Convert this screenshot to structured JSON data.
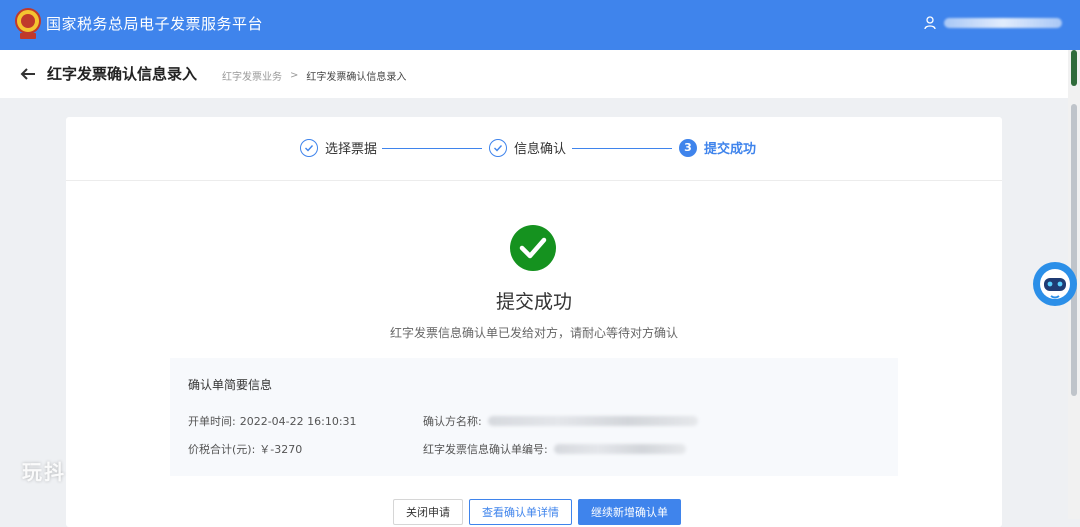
{
  "topbar": {
    "app_title": "国家税务总局电子发票服务平台",
    "bg_color": "#3f84ec"
  },
  "header": {
    "title": "红字发票确认信息录入",
    "breadcrumb": [
      "红字发票业务",
      "红字发票确认信息录入"
    ],
    "breadcrumb_sep": ">"
  },
  "steps": [
    {
      "label": "选择票据",
      "state": "done",
      "icon": "check-circle-icon"
    },
    {
      "label": "信息确认",
      "state": "done",
      "icon": "check-circle-icon"
    },
    {
      "label": "提交成功",
      "state": "active",
      "number": "3"
    }
  ],
  "result": {
    "title": "提交成功",
    "description": "红字发票信息确认单已发给对方，请耐心等待对方确认",
    "icon": "success-check-icon",
    "icon_color": "#15921f"
  },
  "summary": {
    "title": "确认单简要信息",
    "open_time_label": "开单时间:",
    "open_time_value": "2022-04-22 16:10:31",
    "amount_label": "价税合计(元):",
    "amount_value": "￥-3270",
    "confirm_party_label": "确认方名称:",
    "confirm_no_label": "红字发票信息确认单编号:"
  },
  "buttons": {
    "close": "关闭申请",
    "view_detail": "查看确认单详情",
    "continue_add": "继续新增确认单"
  },
  "watermark": "玩抖"
}
